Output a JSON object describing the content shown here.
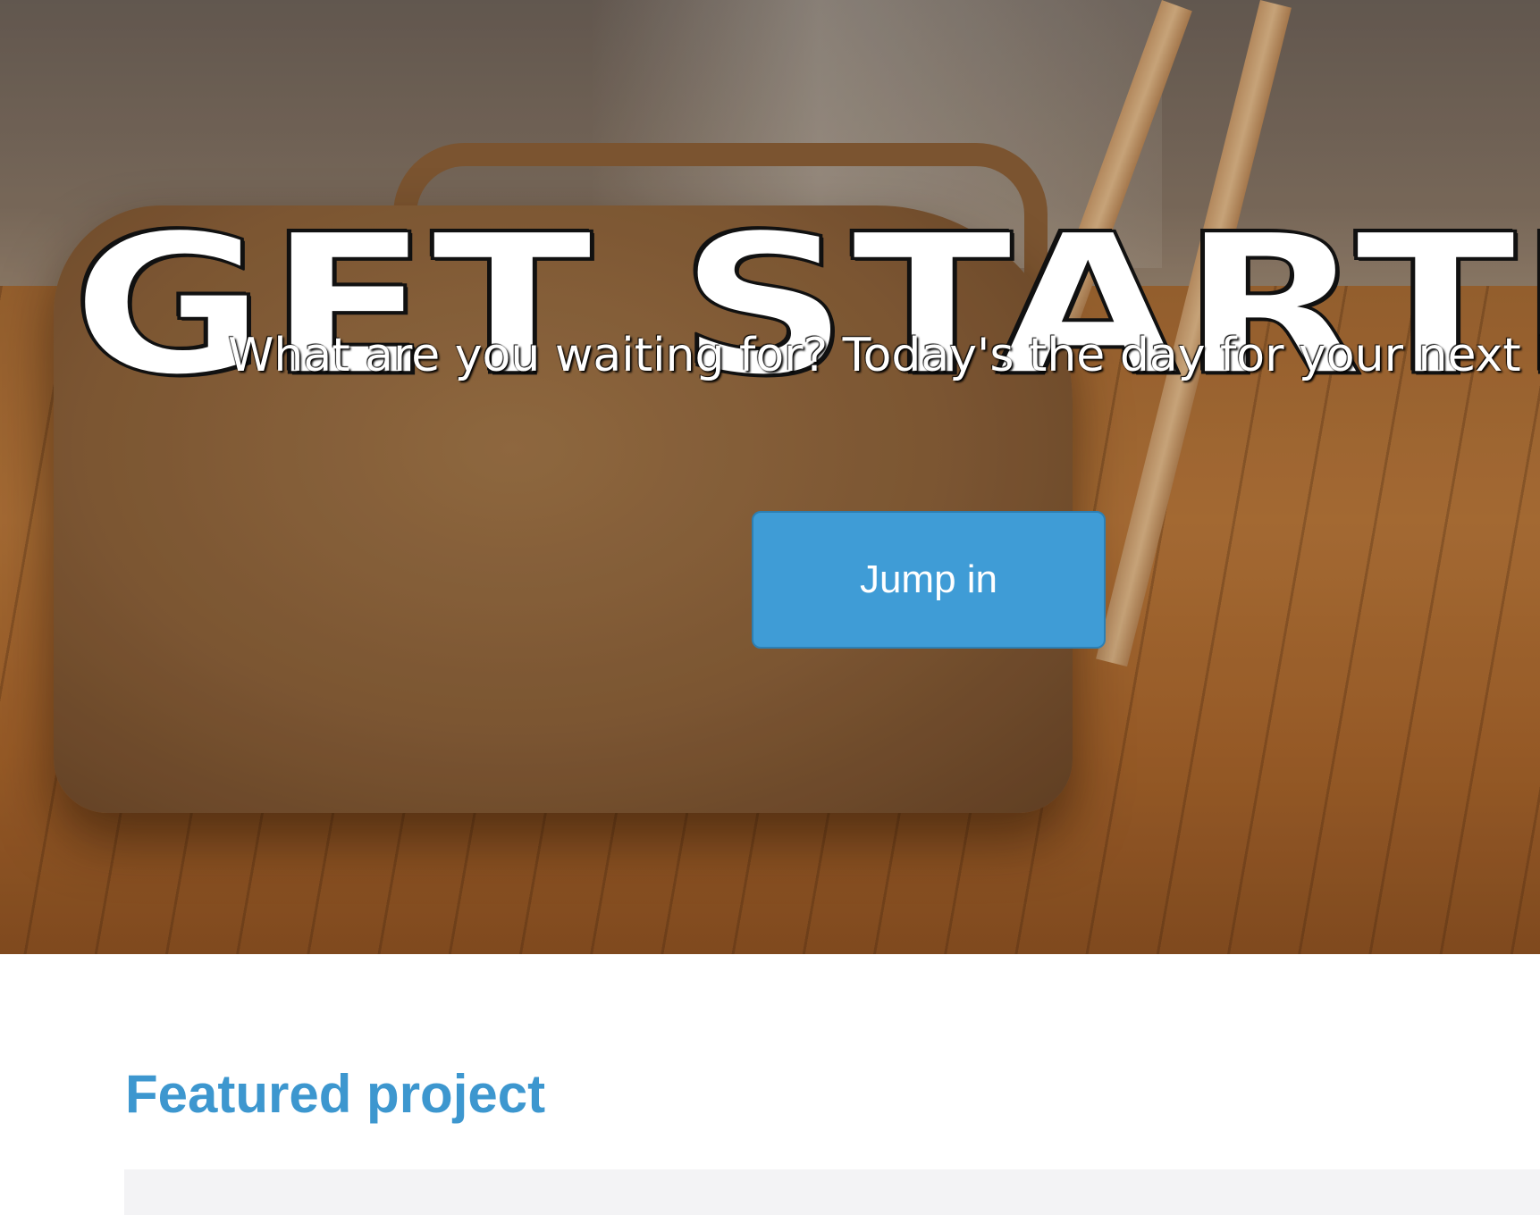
{
  "hero": {
    "headline": "GET STARTE",
    "subtitle": "What are you waiting for? Today's the day for your next big i",
    "cta_label": "Jump in"
  },
  "featured": {
    "title": "Featured project"
  },
  "colors": {
    "accent": "#3f9cd6",
    "title_blue": "#3d97cf",
    "panel_bg": "#f3f3f5"
  }
}
